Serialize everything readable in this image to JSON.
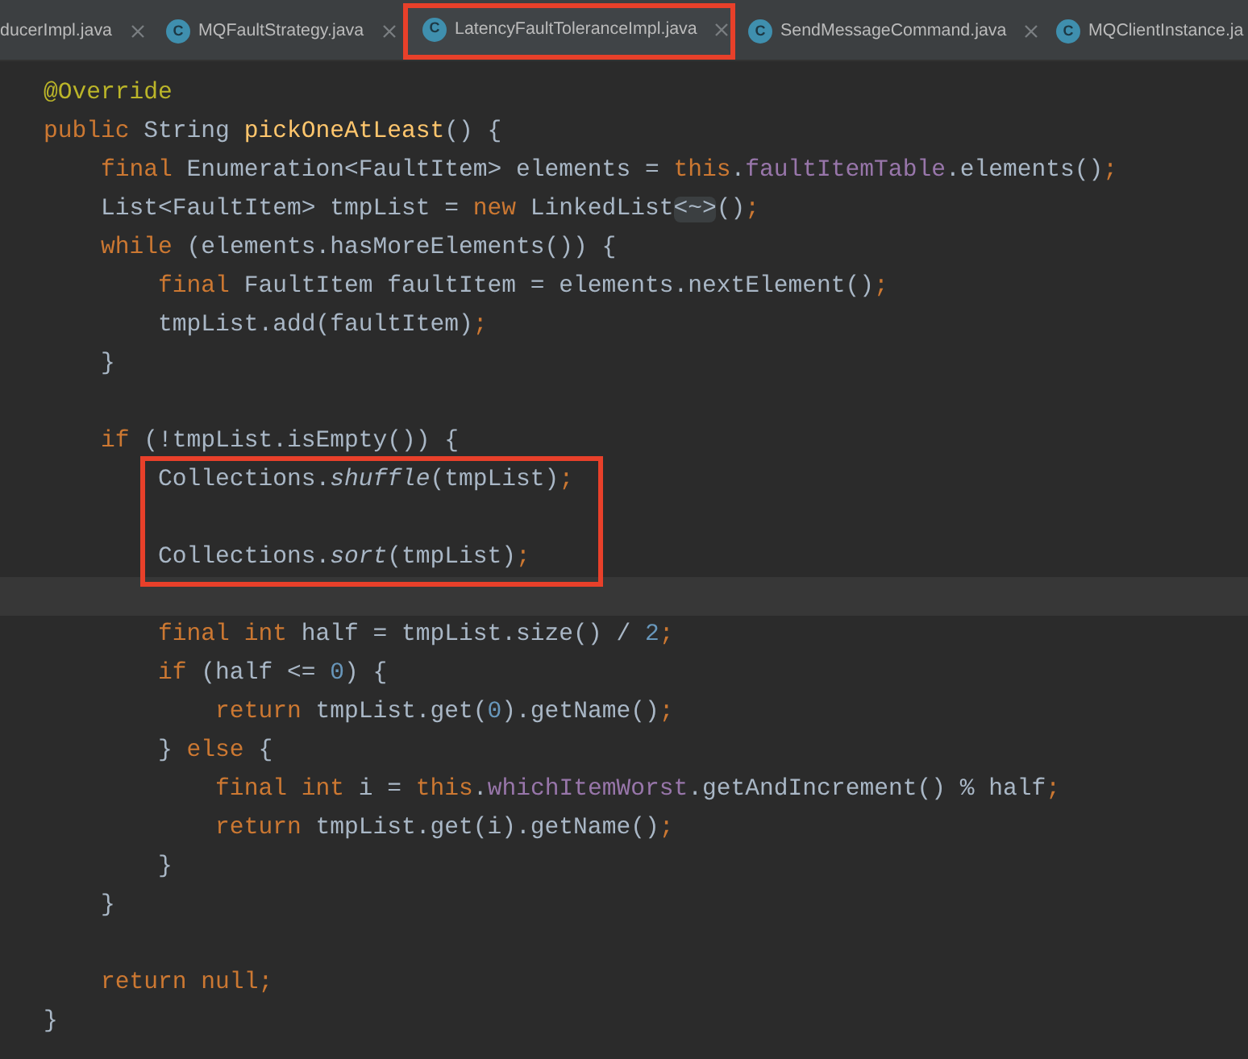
{
  "tabs": [
    {
      "label": "ducerImpl.java",
      "selected": false,
      "marked": false,
      "closable": true
    },
    {
      "label": "MQFaultStrategy.java",
      "icon": "C",
      "selected": false,
      "marked": false,
      "closable": true
    },
    {
      "label": "LatencyFaultToleranceImpl.java",
      "icon": "C",
      "selected": true,
      "marked": true,
      "closable": true
    },
    {
      "label": "SendMessageCommand.java",
      "icon": "C",
      "selected": false,
      "marked": false,
      "closable": true
    },
    {
      "label": "MQClientInstance.ja",
      "icon": "C",
      "selected": false,
      "marked": false,
      "closable": false
    }
  ],
  "code": {
    "lines": [
      {
        "tokens": [
          {
            "text": "@Override",
            "kind": "annotation"
          }
        ],
        "boxed": false,
        "current": false
      },
      {
        "tokens": [
          {
            "text": "public",
            "kind": "keyword"
          },
          {
            "text": " String ",
            "kind": "plain"
          },
          {
            "text": "pickOneAtLeast",
            "kind": "function"
          },
          {
            "text": "() {",
            "kind": "plain"
          }
        ],
        "boxed": false,
        "current": false
      },
      {
        "tokens": [
          {
            "text": "    final",
            "kind": "keyword"
          },
          {
            "text": " Enumeration<FaultItem> elements = ",
            "kind": "plain"
          },
          {
            "text": "this",
            "kind": "keyword"
          },
          {
            "text": ".",
            "kind": "plain"
          },
          {
            "text": "faultItemTable",
            "kind": "field"
          },
          {
            "text": ".elements()",
            "kind": "plain"
          },
          {
            "text": ";",
            "kind": "keyword"
          }
        ],
        "boxed": false,
        "current": false
      },
      {
        "tokens": [
          {
            "text": "    List<FaultItem> tmpList = ",
            "kind": "plain"
          },
          {
            "text": "new",
            "kind": "keyword"
          },
          {
            "text": " LinkedList",
            "kind": "plain"
          },
          {
            "text": "<~>",
            "kind": "folded"
          },
          {
            "text": "()",
            "kind": "plain"
          },
          {
            "text": ";",
            "kind": "keyword"
          }
        ],
        "boxed": false,
        "current": false
      },
      {
        "tokens": [
          {
            "text": "    while",
            "kind": "keyword"
          },
          {
            "text": " (elements.hasMoreElements()) {",
            "kind": "plain"
          }
        ],
        "boxed": false,
        "current": false
      },
      {
        "tokens": [
          {
            "text": "        final",
            "kind": "keyword"
          },
          {
            "text": " FaultItem faultItem = elements.nextElement()",
            "kind": "plain"
          },
          {
            "text": ";",
            "kind": "keyword"
          }
        ],
        "boxed": false,
        "current": false
      },
      {
        "tokens": [
          {
            "text": "        tmpList.add(faultItem)",
            "kind": "plain"
          },
          {
            "text": ";",
            "kind": "keyword"
          }
        ],
        "boxed": false,
        "current": false
      },
      {
        "tokens": [
          {
            "text": "    }",
            "kind": "plain"
          }
        ],
        "boxed": false,
        "current": false
      },
      {
        "boxed": false,
        "current": false
      },
      {
        "tokens": [
          {
            "text": "    if",
            "kind": "keyword"
          },
          {
            "text": " (!tmpList.isEmpty()) {",
            "kind": "plain"
          }
        ],
        "boxed": false,
        "current": false
      },
      {
        "tokens": [
          {
            "text": "        Collections.",
            "kind": "plain"
          },
          {
            "text": "shuffle",
            "kind": "static"
          },
          {
            "text": "(tmpList)",
            "kind": "plain"
          },
          {
            "text": ";",
            "kind": "keyword"
          }
        ],
        "boxed": true,
        "current": false
      },
      {
        "boxed": true,
        "current": false
      },
      {
        "tokens": [
          {
            "text": "        Collections.",
            "kind": "plain"
          },
          {
            "text": "sort",
            "kind": "static"
          },
          {
            "text": "(tmpList)",
            "kind": "plain"
          },
          {
            "text": ";",
            "kind": "keyword"
          }
        ],
        "boxed": true,
        "current": false
      },
      {
        "boxed": false,
        "current": true
      },
      {
        "tokens": [
          {
            "text": "        final",
            "kind": "keyword"
          },
          {
            "text": " int",
            "kind": "keyword"
          },
          {
            "text": " half = tmpList.size() / ",
            "kind": "plain"
          },
          {
            "text": "2",
            "kind": "number"
          },
          {
            "text": ";",
            "kind": "keyword"
          }
        ],
        "boxed": false,
        "current": false
      },
      {
        "tokens": [
          {
            "text": "        if",
            "kind": "keyword"
          },
          {
            "text": " (half <= ",
            "kind": "plain"
          },
          {
            "text": "0",
            "kind": "number"
          },
          {
            "text": ") {",
            "kind": "plain"
          }
        ],
        "boxed": false,
        "current": false
      },
      {
        "tokens": [
          {
            "text": "            return",
            "kind": "keyword"
          },
          {
            "text": " tmpList.get(",
            "kind": "plain"
          },
          {
            "text": "0",
            "kind": "number"
          },
          {
            "text": ").getName()",
            "kind": "plain"
          },
          {
            "text": ";",
            "kind": "keyword"
          }
        ],
        "boxed": false,
        "current": false
      },
      {
        "tokens": [
          {
            "text": "        } ",
            "kind": "plain"
          },
          {
            "text": "else",
            "kind": "keyword"
          },
          {
            "text": " {",
            "kind": "plain"
          }
        ],
        "boxed": false,
        "current": false
      },
      {
        "tokens": [
          {
            "text": "            final",
            "kind": "keyword"
          },
          {
            "text": " int",
            "kind": "keyword"
          },
          {
            "text": " i = ",
            "kind": "plain"
          },
          {
            "text": "this",
            "kind": "keyword"
          },
          {
            "text": ".",
            "kind": "plain"
          },
          {
            "text": "whichItemWorst",
            "kind": "field"
          },
          {
            "text": ".getAndIncrement() % half",
            "kind": "plain"
          },
          {
            "text": ";",
            "kind": "keyword"
          }
        ],
        "boxed": false,
        "current": false
      },
      {
        "tokens": [
          {
            "text": "            return",
            "kind": "keyword"
          },
          {
            "text": " tmpList.get(i).getName()",
            "kind": "plain"
          },
          {
            "text": ";",
            "kind": "keyword"
          }
        ],
        "boxed": false,
        "current": false
      },
      {
        "tokens": [
          {
            "text": "        }",
            "kind": "plain"
          }
        ],
        "boxed": false,
        "current": false
      },
      {
        "tokens": [
          {
            "text": "    }",
            "kind": "plain"
          }
        ],
        "boxed": false,
        "current": false
      },
      {
        "boxed": false,
        "current": false
      },
      {
        "tokens": [
          {
            "text": "    return",
            "kind": "keyword"
          },
          {
            "text": " null",
            "kind": "keyword"
          },
          {
            "text": ";",
            "kind": "keyword"
          }
        ],
        "boxed": false,
        "current": false
      },
      {
        "tokens": [
          {
            "text": "}",
            "kind": "plain"
          }
        ],
        "boxed": false,
        "current": false
      }
    ]
  }
}
